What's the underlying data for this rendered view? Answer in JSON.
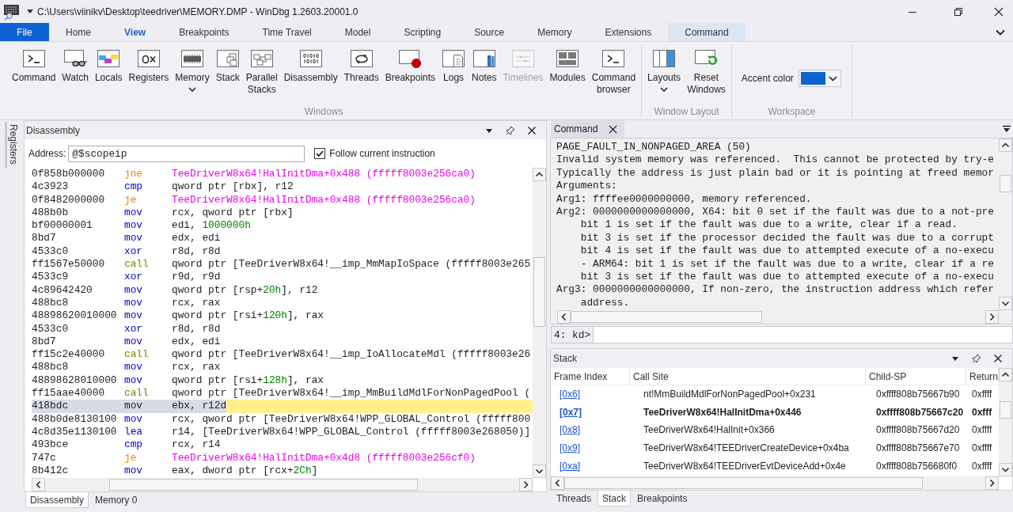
{
  "window": {
    "title": "C:\\Users\\viinikv\\Desktop\\teedriver\\MEMORY.DMP - WinDbg 1.2603.20001.0"
  },
  "ribbon_tabs": [
    {
      "label": "File",
      "kind": "file",
      "selected": false
    },
    {
      "label": "Home",
      "kind": "tab",
      "selected": false
    },
    {
      "label": "View",
      "kind": "tab",
      "selected": true
    },
    {
      "label": "Breakpoints",
      "kind": "tab",
      "selected": false
    },
    {
      "label": "Time Travel",
      "kind": "tab",
      "selected": false
    },
    {
      "label": "Model",
      "kind": "tab",
      "selected": false
    },
    {
      "label": "Scripting",
      "kind": "tab",
      "selected": false
    },
    {
      "label": "Source",
      "kind": "tab",
      "selected": false
    },
    {
      "label": "Memory",
      "kind": "tab",
      "selected": false
    },
    {
      "label": "Extensions",
      "kind": "tab",
      "selected": false
    },
    {
      "label": "Command",
      "kind": "contextual",
      "selected": false
    }
  ],
  "ribbon": {
    "groups": [
      {
        "label": "Windows",
        "buttons": [
          {
            "label": "Command",
            "kind": "button",
            "disabled": false
          },
          {
            "label": "Watch",
            "kind": "button",
            "disabled": false
          },
          {
            "label": "Locals",
            "kind": "button",
            "disabled": false
          },
          {
            "label": "Registers",
            "kind": "button",
            "disabled": false
          },
          {
            "label": "Memory",
            "kind": "dropdown",
            "disabled": false
          },
          {
            "label": "Stack",
            "kind": "button",
            "disabled": false
          },
          {
            "label": "Parallel Stacks",
            "kind": "button",
            "disabled": false
          },
          {
            "label": "Disassembly",
            "kind": "button",
            "disabled": false
          },
          {
            "label": "Threads",
            "kind": "button",
            "disabled": false
          },
          {
            "label": "Breakpoints",
            "kind": "button",
            "disabled": false
          },
          {
            "label": "Logs",
            "kind": "button",
            "disabled": false
          },
          {
            "label": "Notes",
            "kind": "button",
            "disabled": false
          },
          {
            "label": "Timelines",
            "kind": "button",
            "disabled": true
          },
          {
            "label": "Modules",
            "kind": "button",
            "disabled": false
          },
          {
            "label": "Command browser",
            "kind": "button",
            "disabled": false
          }
        ]
      },
      {
        "label": "Window Layout",
        "buttons": [
          {
            "label": "Layouts",
            "kind": "dropdown",
            "disabled": false
          },
          {
            "label": "Reset Windows",
            "kind": "button",
            "disabled": false
          }
        ]
      },
      {
        "label": "Workspace",
        "accent": {
          "label": "Accent color",
          "color": "#0a64d2"
        }
      }
    ]
  },
  "side_tabs": [
    {
      "label": "Registers"
    }
  ],
  "disassembly": {
    "title": "Disassembly",
    "address_label": "Address:",
    "address": "@$scopeip",
    "follow": {
      "label": "Follow current instruction",
      "checked": true
    },
    "rows": [
      {
        "bytes": "0f858b000000",
        "mnemonic": "jne",
        "kind": "jump",
        "operand": [
          {
            "text": "TeeDriverW8x64!HalInitDma+0x488 (fffff8003e256ca0)",
            "kind": "target"
          }
        ],
        "current": false
      },
      {
        "bytes": "4c3923",
        "mnemonic": "cmp",
        "kind": "op",
        "operand": [
          {
            "text": "qword ptr [rbx], r12",
            "kind": "plain"
          }
        ],
        "current": false
      },
      {
        "bytes": "0f8482000000",
        "mnemonic": "je",
        "kind": "jump",
        "operand": [
          {
            "text": "TeeDriverW8x64!HalInitDma+0x488 (fffff8003e256ca0)",
            "kind": "target"
          }
        ],
        "current": false
      },
      {
        "bytes": "488b0b",
        "mnemonic": "mov",
        "kind": "op",
        "operand": [
          {
            "text": "rcx, qword ptr [rbx]",
            "kind": "plain"
          }
        ],
        "current": false
      },
      {
        "bytes": "bf00000001",
        "mnemonic": "mov",
        "kind": "op",
        "operand": [
          {
            "text": "edi, ",
            "kind": "plain"
          },
          {
            "text": "1000000h",
            "kind": "number"
          }
        ],
        "current": false
      },
      {
        "bytes": "8bd7",
        "mnemonic": "mov",
        "kind": "op",
        "operand": [
          {
            "text": "edx, edi",
            "kind": "plain"
          }
        ],
        "current": false
      },
      {
        "bytes": "4533c0",
        "mnemonic": "xor",
        "kind": "op",
        "operand": [
          {
            "text": "r8d, r8d",
            "kind": "plain"
          }
        ],
        "current": false
      },
      {
        "bytes": "ff1567e50000",
        "mnemonic": "call",
        "kind": "call",
        "operand": [
          {
            "text": "qword ptr [TeeDriverW8x64!__imp_MmMapIoSpace (fffff8003e265",
            "kind": "plain"
          }
        ],
        "current": false
      },
      {
        "bytes": "4533c9",
        "mnemonic": "xor",
        "kind": "op",
        "operand": [
          {
            "text": "r9d, r9d",
            "kind": "plain"
          }
        ],
        "current": false
      },
      {
        "bytes": "4c89642420",
        "mnemonic": "mov",
        "kind": "op",
        "operand": [
          {
            "text": "qword ptr [rsp+",
            "kind": "plain"
          },
          {
            "text": "20h",
            "kind": "number"
          },
          {
            "text": "], r12",
            "kind": "plain"
          }
        ],
        "current": false
      },
      {
        "bytes": "488bc8",
        "mnemonic": "mov",
        "kind": "op",
        "operand": [
          {
            "text": "rcx, rax",
            "kind": "plain"
          }
        ],
        "current": false
      },
      {
        "bytes": "48898620010000",
        "mnemonic": "mov",
        "kind": "op",
        "operand": [
          {
            "text": "qword ptr [rsi+",
            "kind": "plain"
          },
          {
            "text": "120h",
            "kind": "number"
          },
          {
            "text": "], rax",
            "kind": "plain"
          }
        ],
        "current": false
      },
      {
        "bytes": "4533c0",
        "mnemonic": "xor",
        "kind": "op",
        "operand": [
          {
            "text": "r8d, r8d",
            "kind": "plain"
          }
        ],
        "current": false
      },
      {
        "bytes": "8bd7",
        "mnemonic": "mov",
        "kind": "op",
        "operand": [
          {
            "text": "edx, edi",
            "kind": "plain"
          }
        ],
        "current": false
      },
      {
        "bytes": "ff15c2e40000",
        "mnemonic": "call",
        "kind": "call",
        "operand": [
          {
            "text": "qword ptr [TeeDriverW8x64!__imp_IoAllocateMdl (fffff8003e26",
            "kind": "plain"
          }
        ],
        "current": false
      },
      {
        "bytes": "488bc8",
        "mnemonic": "mov",
        "kind": "op",
        "operand": [
          {
            "text": "rcx, rax",
            "kind": "plain"
          }
        ],
        "current": false
      },
      {
        "bytes": "48898628010000",
        "mnemonic": "mov",
        "kind": "op",
        "operand": [
          {
            "text": "qword ptr [rsi+",
            "kind": "plain"
          },
          {
            "text": "128h",
            "kind": "number"
          },
          {
            "text": "], rax",
            "kind": "plain"
          }
        ],
        "current": false
      },
      {
        "bytes": "ff15aae40000",
        "mnemonic": "call",
        "kind": "call",
        "operand": [
          {
            "text": "qword ptr [TeeDriverW8x64!__imp_MmBuildMdlForNonPagedPool (",
            "kind": "plain"
          }
        ],
        "current": false
      },
      {
        "bytes": "418bdc",
        "mnemonic": "mov",
        "kind": "op",
        "operand": [
          {
            "text": "ebx, r12d",
            "kind": "plain"
          }
        ],
        "current": true
      },
      {
        "bytes": "488b0de8130100",
        "mnemonic": "mov",
        "kind": "op",
        "operand": [
          {
            "text": "rcx, qword ptr [TeeDriverW8x64!WPP_GLOBAL_Control (fffff800",
            "kind": "plain"
          }
        ],
        "current": false
      },
      {
        "bytes": "4c8d35e1130100",
        "mnemonic": "lea",
        "kind": "op",
        "operand": [
          {
            "text": "r14, [TeeDriverW8x64!WPP_GLOBAL_Control (fffff8003e268050)]",
            "kind": "plain"
          }
        ],
        "current": false
      },
      {
        "bytes": "493bce",
        "mnemonic": "cmp",
        "kind": "op",
        "operand": [
          {
            "text": "rcx, r14",
            "kind": "plain"
          }
        ],
        "current": false
      },
      {
        "bytes": "747c",
        "mnemonic": "je",
        "kind": "jump",
        "operand": [
          {
            "text": "TeeDriverW8x64!HalInitDma+0x4d8 (fffff8003e256cf0)",
            "kind": "target"
          }
        ],
        "current": false
      },
      {
        "bytes": "8b412c",
        "mnemonic": "mov",
        "kind": "op",
        "operand": [
          {
            "text": "eax, dword ptr [rcx+",
            "kind": "plain"
          },
          {
            "text": "2Ch",
            "kind": "number"
          },
          {
            "text": "]",
            "kind": "plain"
          }
        ],
        "current": false
      }
    ],
    "tabs": [
      {
        "label": "Disassembly",
        "selected": true
      },
      {
        "label": "Memory 0",
        "selected": false
      }
    ]
  },
  "command": {
    "tab": {
      "label": "Command",
      "selected": true
    },
    "output": [
      "PAGE_FAULT_IN_NONPAGED_AREA (50)",
      "Invalid system memory was referenced.  This cannot be protected by try-e",
      "Typically the address is just plain bad or it is pointing at freed memor",
      "Arguments:",
      "Arg1: ffffee0000000000, memory referenced.",
      "Arg2: 0000000000000000, X64: bit 0 set if the fault was due to a not-pre",
      "    bit 1 is set if the fault was due to a write, clear if a read.",
      "    bit 3 is set if the processor decided the fault was due to a corrupt",
      "    bit 4 is set if the fault was due to attempted execute of a no-execu",
      "    - ARM64: bit 1 is set if the fault was due to a write, clear if a re",
      "    bit 3 is set if the fault was due to attempted execute of a no-execu",
      "Arg3: 0000000000000000, If non-zero, the instruction address which refer",
      "    address."
    ],
    "prompt": "4: kd>"
  },
  "stack": {
    "title": "Stack",
    "columns": [
      "Frame Index",
      "Call Site",
      "Child-SP",
      "Return"
    ],
    "rows": [
      {
        "frame": "[0x6]",
        "call_site": "nt!MmBuildMdlForNonPagedPool+0x231",
        "child_sp": "0xffff808b75667b90",
        "return": "0xffff",
        "current": false
      },
      {
        "frame": "[0x7]",
        "call_site": "TeeDriverW8x64!HalInitDma+0x446",
        "child_sp": "0xffff808b75667c20",
        "return": "0xfff",
        "current": true
      },
      {
        "frame": "[0x8]",
        "call_site": "TeeDriverW8x64!HalInit+0x366",
        "child_sp": "0xffff808b75667d20",
        "return": "0xffff",
        "current": false
      },
      {
        "frame": "[0x9]",
        "call_site": "TeeDriverW8x64!TEEDriverCreateDevice+0x4ba",
        "child_sp": "0xffff808b75667e70",
        "return": "0xffff",
        "current": false
      },
      {
        "frame": "[0xa]",
        "call_site": "TeeDriverW8x64!TEEDriverEvtDeviceAdd+0x4e",
        "child_sp": "0xffff808b756680f0",
        "return": "0xffff",
        "current": false
      }
    ],
    "tabs": [
      {
        "label": "Threads",
        "selected": false
      },
      {
        "label": "Stack",
        "selected": true
      },
      {
        "label": "Breakpoints",
        "selected": false
      }
    ]
  }
}
